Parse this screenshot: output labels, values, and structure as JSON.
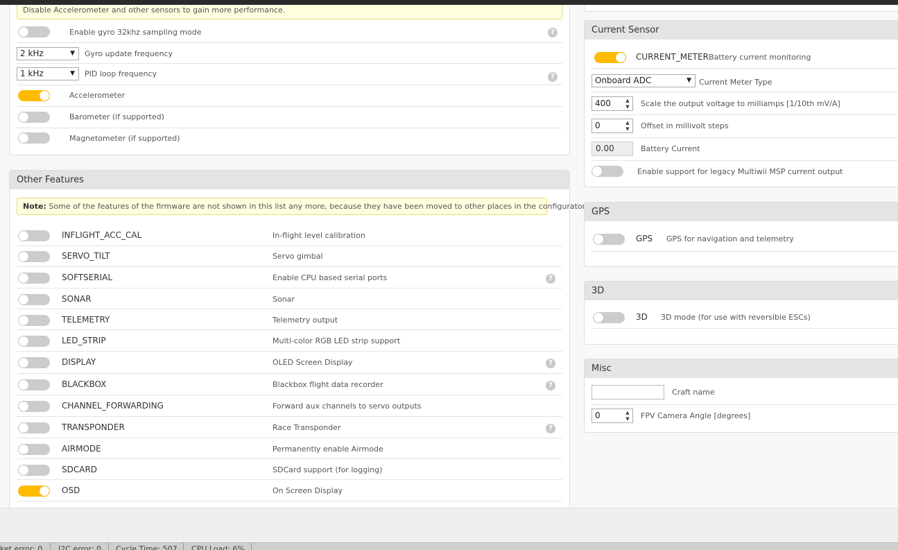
{
  "sensors": {
    "warning": "Disable Accelerometer and other sensors to gain more performance.",
    "gyro32": {
      "label": "Enable gyro 32khz sampling mode",
      "on": false
    },
    "gyro_freq": {
      "value": "2 kHz",
      "label": "Gyro update frequency"
    },
    "pid_freq": {
      "value": "1 kHz",
      "label": "PID loop frequency"
    },
    "accelerometer": {
      "label": "Accelerometer",
      "on": true
    },
    "barometer": {
      "label": "Barometer (if supported)",
      "on": false
    },
    "magnetometer": {
      "label": "Magnetometer (if supported)",
      "on": false
    }
  },
  "other_features": {
    "title": "Other Features",
    "note_bold": "Note:",
    "note_text": "Some of the features of the firmware are not shown in this list any more, because they have been moved to other places in the configurator.",
    "features": [
      {
        "name": "INFLIGHT_ACC_CAL",
        "desc": "In-flight level calibration",
        "on": false,
        "help": false
      },
      {
        "name": "SERVO_TILT",
        "desc": "Servo gimbal",
        "on": false,
        "help": false
      },
      {
        "name": "SOFTSERIAL",
        "desc": "Enable CPU based serial ports",
        "on": false,
        "help": true
      },
      {
        "name": "SONAR",
        "desc": "Sonar",
        "on": false,
        "help": false
      },
      {
        "name": "TELEMETRY",
        "desc": "Telemetry output",
        "on": false,
        "help": false
      },
      {
        "name": "LED_STRIP",
        "desc": "Multi-color RGB LED strip support",
        "on": false,
        "help": false
      },
      {
        "name": "DISPLAY",
        "desc": "OLED Screen Display",
        "on": false,
        "help": true
      },
      {
        "name": "BLACKBOX",
        "desc": "Blackbox flight data recorder",
        "on": false,
        "help": true
      },
      {
        "name": "CHANNEL_FORWARDING",
        "desc": "Forward aux channels to servo outputs",
        "on": false,
        "help": false
      },
      {
        "name": "TRANSPONDER",
        "desc": "Race Transponder",
        "on": false,
        "help": true
      },
      {
        "name": "AIRMODE",
        "desc": "Permanently enable Airmode",
        "on": false,
        "help": false
      },
      {
        "name": "SDCARD",
        "desc": "SDCard support (for logging)",
        "on": false,
        "help": false
      },
      {
        "name": "OSD",
        "desc": "On Screen Display",
        "on": true,
        "help": false
      }
    ]
  },
  "current_sensor": {
    "title": "Current Sensor",
    "meter_name": "CURRENT_METER",
    "meter_desc": "Battery current monitoring",
    "meter_on": true,
    "type_value": "Onboard ADC",
    "type_label": "Current Meter Type",
    "scale_value": "400",
    "scale_label": "Scale the output voltage to milliamps [1/10th mV/A]",
    "offset_value": "0",
    "offset_label": "Offset in millivolt steps",
    "battery_value": "0.00",
    "battery_label": "Battery Current",
    "legacy_label": "Enable support for legacy Multiwii MSP current output",
    "legacy_on": false
  },
  "gps": {
    "title": "GPS",
    "name": "GPS",
    "desc": "GPS for navigation and telemetry",
    "on": false
  },
  "three_d": {
    "title": "3D",
    "name": "3D",
    "desc": "3D mode (for use with reversible ESCs)",
    "on": false
  },
  "misc": {
    "title": "Misc",
    "craft_label": "Craft name",
    "craft_value": "",
    "fpv_value": "0",
    "fpv_label": "FPV Camera Angle [degrees]"
  },
  "status": {
    "packet_error": "ket error: 0",
    "i2c_error": "I2C error: 0",
    "cycle_time": "Cycle Time: 507",
    "cpu_load": "CPU Load: 6%"
  },
  "help_glyph": "?",
  "arrow_glyph": "▼",
  "spin_glyph": "▲▼",
  "colors": {
    "accent": "#ffbb00",
    "toggle_off": "#cccccc"
  }
}
